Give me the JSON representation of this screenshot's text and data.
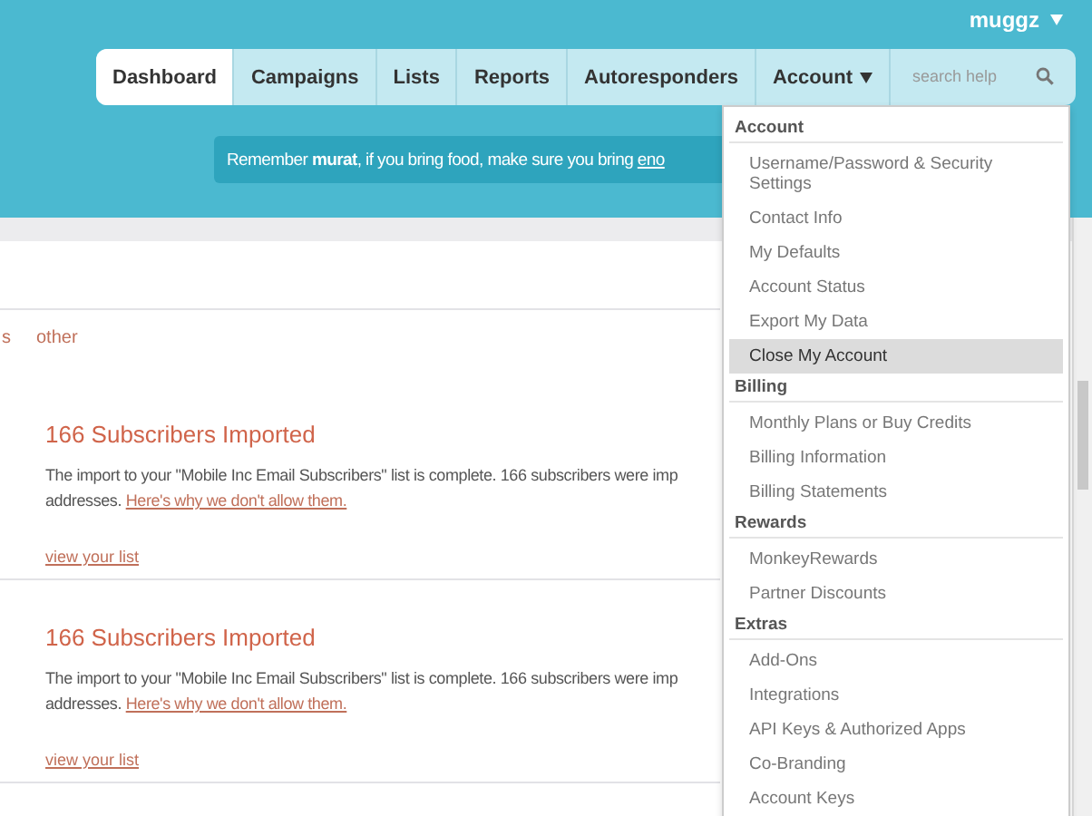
{
  "user_menu": {
    "label": "muggz"
  },
  "nav": {
    "tabs": [
      {
        "label": "Dashboard",
        "selected": true
      },
      {
        "label": "Campaigns",
        "selected": false
      },
      {
        "label": "Lists",
        "selected": false
      },
      {
        "label": "Reports",
        "selected": false
      },
      {
        "label": "Autoresponders",
        "selected": false
      },
      {
        "label": "Account",
        "selected": false
      }
    ],
    "search": {
      "placeholder": "search help"
    }
  },
  "banner": {
    "text": "Remember **murat**, if you bring food, make sure you bring",
    "link": "eno"
  },
  "filters": [
    {
      "label": "s"
    },
    {
      "label": "other"
    }
  ],
  "notices": [
    {
      "title": "166 Subscribers Imported",
      "text": "The import to your \"Mobile Inc Email Subscribers\" list is complete. 166 subscribers were imp",
      "text_2": "addresses.",
      "link": "Here's why we don't allow them.",
      "action": "view your list"
    },
    {
      "title": "166 Subscribers Imported",
      "text": "The import to your \"Mobile Inc Email Subscribers\" list is complete. 166 subscribers were imp",
      "text_2": "addresses.",
      "link": "Here's why we don't allow them.",
      "action": "view your list"
    }
  ],
  "account_menu": {
    "sections": [
      {
        "title": "Account",
        "items": [
          {
            "label": "Username/Password & Security Settings",
            "selected": false
          },
          {
            "label": "Contact Info",
            "selected": false
          },
          {
            "label": "My Defaults",
            "selected": false
          },
          {
            "label": "Account Status",
            "selected": false
          },
          {
            "label": "Export My Data",
            "selected": false
          },
          {
            "label": "Close My Account",
            "selected": true
          }
        ]
      },
      {
        "title": "Billing",
        "items": [
          {
            "label": "Monthly Plans or Buy Credits",
            "selected": false
          },
          {
            "label": "Billing Information",
            "selected": false
          },
          {
            "label": "Billing Statements",
            "selected": false
          }
        ]
      },
      {
        "title": "Rewards",
        "items": [
          {
            "label": "MonkeyRewards",
            "selected": false
          },
          {
            "label": "Partner Discounts",
            "selected": false
          }
        ]
      },
      {
        "title": "Extras",
        "items": [
          {
            "label": "Add-Ons",
            "selected": false
          },
          {
            "label": "Integrations",
            "selected": false
          },
          {
            "label": "API Keys & Authorized Apps",
            "selected": false
          },
          {
            "label": "Co-Branding",
            "selected": false
          },
          {
            "label": "Account Keys",
            "selected": false
          }
        ]
      }
    ]
  }
}
